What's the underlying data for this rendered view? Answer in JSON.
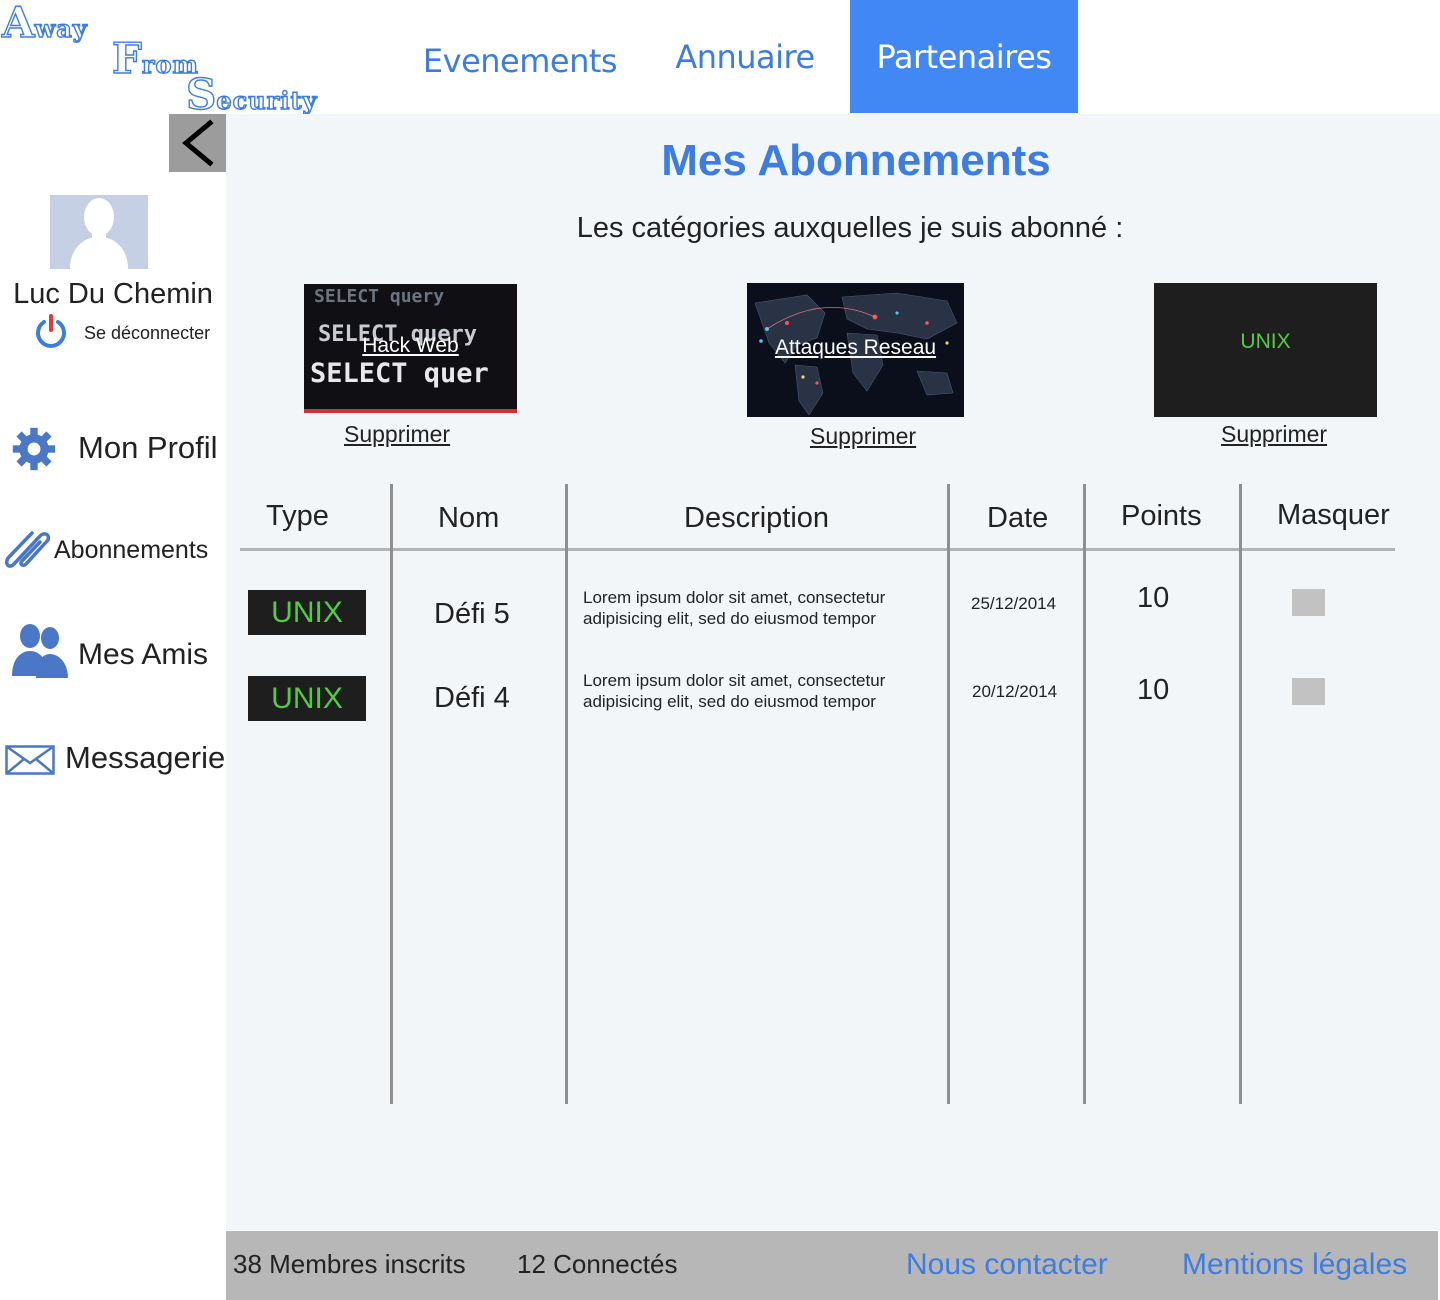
{
  "logo": {
    "line1_cap": "A",
    "line1_rest": "way",
    "line2_cap": "F",
    "line2_rest": "rom",
    "line3_cap": "S",
    "line3_rest": "ecurity"
  },
  "nav": {
    "tabs": [
      {
        "label": "Evenements",
        "active": false
      },
      {
        "label": "Annuaire",
        "active": false
      },
      {
        "label": "Partenaires",
        "active": true
      }
    ],
    "active_color": "#4288f4"
  },
  "sidebar": {
    "back_icon": "chevron-left-icon",
    "user_name": "Luc Du Chemin",
    "logout_label": "Se déconnecter",
    "items": [
      {
        "label": "Mon Profil",
        "icon": "gear-icon"
      },
      {
        "label": "Abonnements",
        "icon": "paperclip-icon"
      },
      {
        "label": "Mes Amis",
        "icon": "users-icon"
      },
      {
        "label": "Messagerie",
        "icon": "envelope-icon"
      }
    ]
  },
  "main": {
    "title": "Mes Abonnements",
    "subtitle": "Les catégories auxquelles je suis abonné :",
    "categories": [
      {
        "label": "Hack Web",
        "delete_label": "Supprimer"
      },
      {
        "label": "Attaques Reseau",
        "delete_label": "Supprimer"
      },
      {
        "label": "UNIX",
        "delete_label": "Supprimer"
      }
    ],
    "table": {
      "headers": [
        "Type",
        "Nom",
        "Description",
        "Date",
        "Points",
        "Masquer"
      ],
      "rows": [
        {
          "type": "UNIX",
          "nom": "Défi 5",
          "description": "Lorem ipsum dolor sit amet, consectetur adipisicing elit, sed do eiusmod tempor",
          "date": "25/12/2014",
          "points": "10",
          "masquer": false
        },
        {
          "type": "UNIX",
          "nom": "Défi 4",
          "description": "Lorem ipsum dolor sit amet, consectetur adipisicing elit, sed do eiusmod tempor",
          "date": "20/12/2014",
          "points": "10",
          "masquer": false
        }
      ]
    }
  },
  "footer": {
    "members": "38 Membres inscrits",
    "connected": "12 Connectés",
    "contact": "Nous contacter",
    "legal": "Mentions légales"
  },
  "colors": {
    "brand_blue": "#3e7de0",
    "badge_green": "#52cc41",
    "badge_bg": "#1e1e1e",
    "power_red": "#e53935"
  }
}
